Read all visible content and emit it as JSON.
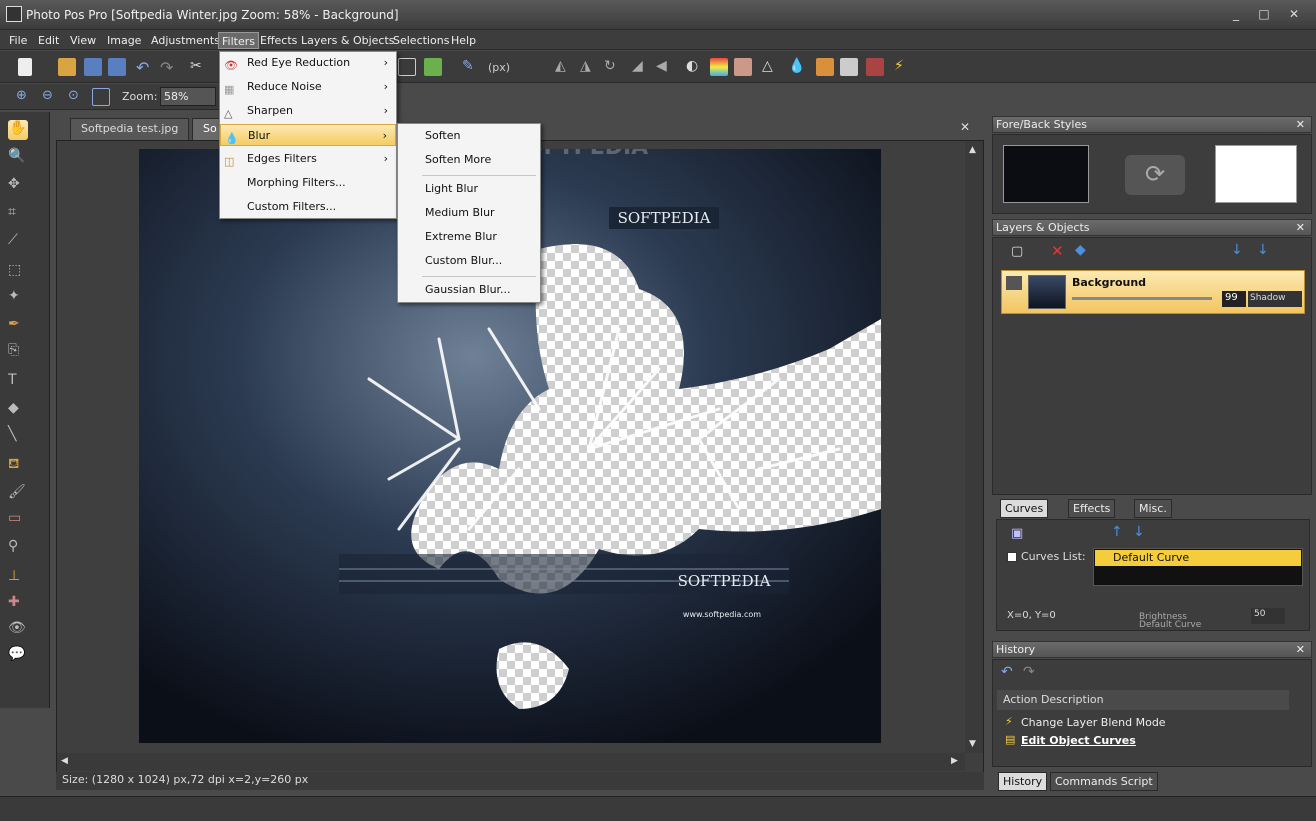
{
  "window": {
    "title": "Photo Pos Pro [Softpedia Winter.jpg Zoom: 58% - Background]",
    "controls": [
      "_",
      "□",
      "✕"
    ]
  },
  "menubar": [
    "File",
    "Edit",
    "View",
    "Image",
    "Adjustments",
    "Filters",
    "Effects",
    "Layers & Objects",
    "Selections",
    "Help"
  ],
  "toolbar": {
    "units": "(px)",
    "zoom_label": "Zoom:",
    "zoom_value": "58%"
  },
  "tabs": [
    "Softpedia test.jpg",
    "So"
  ],
  "filters_menu": {
    "items": [
      "Red Eye Reduction",
      "Reduce Noise",
      "Sharpen",
      "Blur",
      "Edges Filters",
      "Morphing Filters...",
      "Custom Filters..."
    ]
  },
  "blur_submenu": {
    "items": [
      "Soften",
      "Soften More",
      "Light Blur",
      "Medium Blur",
      "Extreme Blur",
      "Custom Blur...",
      "Gaussian Blur..."
    ]
  },
  "canvas": {
    "watermark_top": "SOFTPEDIA",
    "watermark_mid": "SOFTPEDIA",
    "url": "www.softpedia.com",
    "overlay": "SOFTPEDIA"
  },
  "status": {
    "text": "Size: (1280 x 1024) px,72 dpi   x=2,y=260 px"
  },
  "panels": {
    "fore_back": {
      "title": "Fore/Back Styles"
    },
    "layers": {
      "title": "Layers & Objects",
      "layer_name": "Background",
      "opacity": "99",
      "blend": "Shadow"
    },
    "curves": {
      "tabs": [
        "Curves",
        "Effects",
        "Misc."
      ],
      "list_label": "Curves List:",
      "selected_curve": "Default Curve",
      "coords": "X=0, Y=0",
      "brightness_label": "Brightness",
      "brightness_value": "50",
      "curve_label": "Default Curve"
    },
    "history": {
      "title": "History",
      "column": "Action Description",
      "items": [
        "Change Layer Blend Mode",
        "Edit Object Curves"
      ],
      "tabs": [
        "History",
        "Commands Script"
      ]
    }
  },
  "colors": {
    "highlight": "#f5cc63",
    "fore": "#0b0d12",
    "back": "#ffffff"
  }
}
